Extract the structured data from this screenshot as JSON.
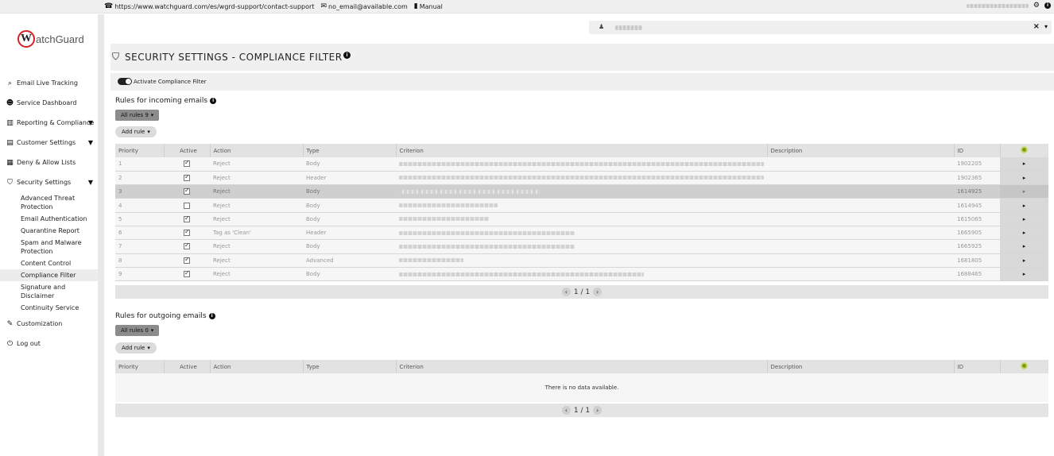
{
  "topbar": {
    "phone_url": "https://www.watchguard.com/es/wgrd-support/contact-support",
    "email": "no_email@available.com",
    "manual": "Manual"
  },
  "logo": {
    "text": "atchGuard",
    "letter": "W"
  },
  "sidebar": {
    "items": [
      {
        "icon": "search-icon",
        "glyph": "🔍",
        "label": "Email Live Tracking"
      },
      {
        "icon": "users-icon",
        "glyph": "👥",
        "label": "Service Dashboard"
      },
      {
        "icon": "chart-icon",
        "glyph": "📈",
        "label": "Reporting & Compliance",
        "caret": true
      },
      {
        "icon": "card-icon",
        "glyph": "▤",
        "label": "Customer Settings",
        "caret": true
      },
      {
        "icon": "list-icon",
        "glyph": "▦",
        "label": "Deny & Allow Lists"
      },
      {
        "icon": "shield-icon",
        "glyph": "⛊",
        "label": "Security Settings",
        "caret": true
      }
    ],
    "security_sub": [
      "Advanced Threat Protection",
      "Email Authentication",
      "Quarantine Report",
      "Spam and Malware Protection",
      "Content Control",
      "Compliance Filter",
      "Signature and Disclaimer",
      "Continuity Service"
    ],
    "active_sub": "Compliance Filter",
    "bottom_items": [
      {
        "icon": "brush-icon",
        "glyph": "🖌",
        "label": "Customization"
      },
      {
        "icon": "power-icon",
        "glyph": "⏻",
        "label": "Log out"
      }
    ]
  },
  "page": {
    "title": "SECURITY SETTINGS - COMPLIANCE FILTER",
    "toggle_label": "Activate Compliance Filter",
    "toggle_on": true
  },
  "incoming": {
    "title": "Rules for incoming emails",
    "filter_label": "All rules 9",
    "add_label": "Add rule",
    "columns": [
      "Priority",
      "Active",
      "Action",
      "Type",
      "Criterion",
      "Description",
      "ID"
    ],
    "rows": [
      {
        "priority": "1",
        "active": true,
        "action": "Reject",
        "type": "Body",
        "id": "1902205",
        "crit_len": 0.85
      },
      {
        "priority": "2",
        "active": true,
        "action": "Reject",
        "type": "Header",
        "id": "1902365",
        "crit_len": 0.85
      },
      {
        "priority": "3",
        "active": true,
        "action": "Reject",
        "type": "Body",
        "id": "1614925",
        "crit_len": 0.33,
        "selected": true
      },
      {
        "priority": "4",
        "active": false,
        "action": "Reject",
        "type": "Body",
        "id": "1614945",
        "crit_len": 0.23
      },
      {
        "priority": "5",
        "active": true,
        "action": "Reject",
        "type": "Body",
        "id": "1615065",
        "crit_len": 0.21
      },
      {
        "priority": "6",
        "active": true,
        "action": "Tag as 'Clean'",
        "type": "Header",
        "id": "1665905",
        "crit_len": 0.41
      },
      {
        "priority": "7",
        "active": true,
        "action": "Reject",
        "type": "Body",
        "id": "1665925",
        "crit_len": 0.41
      },
      {
        "priority": "8",
        "active": true,
        "action": "Reject",
        "type": "Advanced",
        "id": "1681805",
        "crit_len": 0.15
      },
      {
        "priority": "9",
        "active": true,
        "action": "Reject",
        "type": "Body",
        "id": "1688465",
        "crit_len": 0.57
      }
    ],
    "pager": "1 / 1"
  },
  "outgoing": {
    "title": "Rules for outgoing emails",
    "filter_label": "All rules 0",
    "add_label": "Add rule",
    "columns": [
      "Priority",
      "Active",
      "Action",
      "Type",
      "Criterion",
      "Description",
      "ID"
    ],
    "empty": "There is no data available.",
    "pager": "1 / 1"
  },
  "colors": {
    "accent_red": "#d71f26",
    "settings_green": "#7a9a14"
  }
}
